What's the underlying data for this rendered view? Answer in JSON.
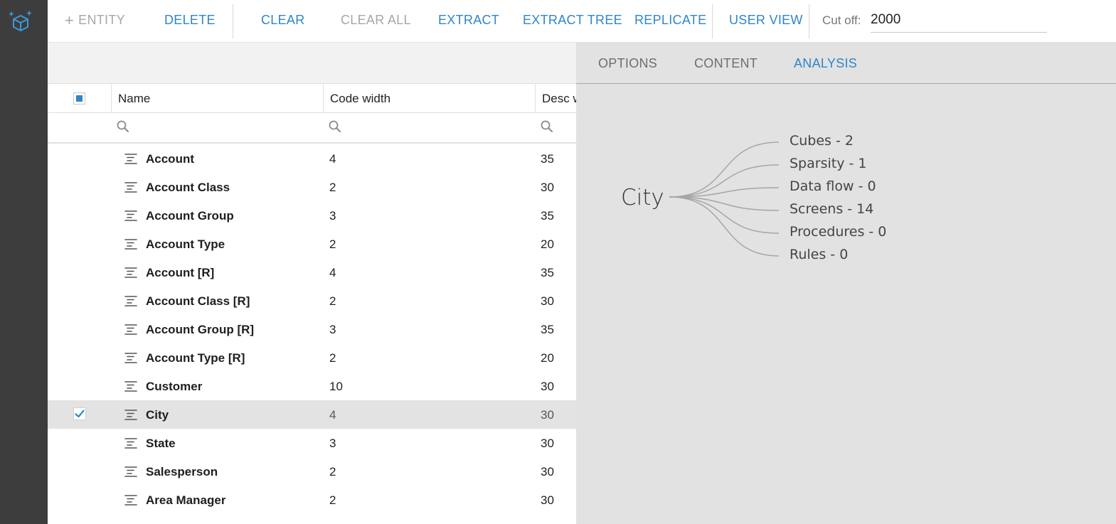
{
  "toolbar": {
    "entity_label": "ENTITY",
    "delete_label": "DELETE",
    "clear_label": "CLEAR",
    "clear_all_label": "CLEAR ALL",
    "extract_label": "EXTRACT",
    "extract_tree_label": "EXTRACT TREE",
    "replicate_label": "REPLICATE",
    "user_view_label": "USER VIEW",
    "cutoff_label": "Cut off:",
    "cutoff_value": "2000"
  },
  "grid": {
    "columns": [
      "Name",
      "Code width",
      "Desc w"
    ],
    "rows": [
      {
        "name": "Account",
        "code": "4",
        "desc": "35",
        "checked": false
      },
      {
        "name": "Account Class",
        "code": "2",
        "desc": "30",
        "checked": false
      },
      {
        "name": "Account Group",
        "code": "3",
        "desc": "35",
        "checked": false
      },
      {
        "name": "Account Type",
        "code": "2",
        "desc": "20",
        "checked": false
      },
      {
        "name": "Account [R]",
        "code": "4",
        "desc": "35",
        "checked": false
      },
      {
        "name": "Account Class [R]",
        "code": "2",
        "desc": "30",
        "checked": false
      },
      {
        "name": "Account Group [R]",
        "code": "3",
        "desc": "35",
        "checked": false
      },
      {
        "name": "Account Type [R]",
        "code": "2",
        "desc": "20",
        "checked": false
      },
      {
        "name": "Customer",
        "code": "10",
        "desc": "30",
        "checked": false
      },
      {
        "name": "City",
        "code": "4",
        "desc": "30",
        "checked": true
      },
      {
        "name": "State",
        "code": "3",
        "desc": "30",
        "checked": false
      },
      {
        "name": "Salesperson",
        "code": "2",
        "desc": "30",
        "checked": false
      },
      {
        "name": "Area Manager",
        "code": "2",
        "desc": "30",
        "checked": false
      }
    ]
  },
  "tabs": {
    "options": "OPTIONS",
    "content": "CONTENT",
    "analysis": "ANALYSIS",
    "active": "analysis"
  },
  "analysis": {
    "root": "City",
    "leaves": [
      "Cubes - 2",
      "Sparsity - 1",
      "Data flow - 0",
      "Screens - 14",
      "Procedures - 0",
      "Rules - 0"
    ]
  },
  "colors": {
    "accent": "#2f86c8",
    "rail": "#3d3d3d",
    "panel_bg": "#e2e2e2",
    "selected_row": "#e3e3e3",
    "disabled": "#a7a7a7"
  },
  "icons": {
    "logo": "cube-sparkle-icon",
    "entity_add": "plus-icon",
    "filter": "search-icon",
    "row_type": "list-lines-icon",
    "row_check": "checkmark-icon"
  }
}
